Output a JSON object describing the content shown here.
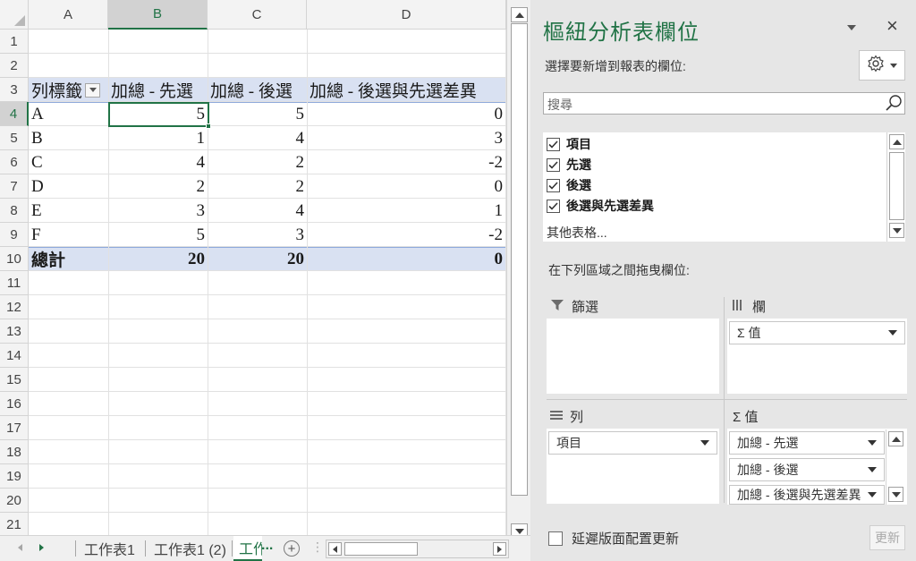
{
  "sheet": {
    "columns": [
      "A",
      "B",
      "C",
      "D"
    ],
    "rows": [
      "1",
      "2",
      "3",
      "4",
      "5",
      "6",
      "7",
      "8",
      "9",
      "10",
      "11",
      "12",
      "13",
      "14",
      "15",
      "16",
      "17",
      "18",
      "19",
      "20",
      "21"
    ],
    "pivot": {
      "header": [
        "列標籤",
        "加總 - 先選",
        "加總 - 後選",
        "加總 - 後選與先選差異"
      ],
      "data": [
        [
          "A",
          "5",
          "5",
          "0"
        ],
        [
          "B",
          "1",
          "4",
          "3"
        ],
        [
          "C",
          "4",
          "2",
          "-2"
        ],
        [
          "D",
          "2",
          "2",
          "0"
        ],
        [
          "E",
          "3",
          "4",
          "1"
        ],
        [
          "F",
          "5",
          "3",
          "-2"
        ]
      ],
      "total": [
        "總計",
        "20",
        "20",
        "0"
      ]
    },
    "active_cell": "B4"
  },
  "tabs": {
    "items": [
      "工作表1",
      "工作表1 (2)",
      "工作表"
    ],
    "active_index": 2,
    "more": "...",
    "add": "+"
  },
  "pane": {
    "title": "樞紐分析表欄位",
    "close": "×",
    "choose_label": "選擇要新增到報表的欄位:",
    "search_placeholder": "搜尋",
    "fields": [
      {
        "label": "項目",
        "checked": true
      },
      {
        "label": "先選",
        "checked": true
      },
      {
        "label": "後選",
        "checked": true
      },
      {
        "label": "後選與先選差異",
        "checked": true
      }
    ],
    "more_tables": "其他表格...",
    "drag_label": "在下列區域之間拖曳欄位:",
    "areas": {
      "filters": {
        "label": "篩選",
        "items": []
      },
      "columns": {
        "label": "欄",
        "items": [
          "Σ 值"
        ]
      },
      "rows": {
        "label": "列",
        "items": [
          "項目"
        ]
      },
      "values": {
        "label": "Σ 值",
        "items": [
          "加總 - 先選",
          "加總 - 後選",
          "加總 - 後選與先選差異"
        ]
      }
    },
    "defer_label": "延遲版面配置更新",
    "update_label": "更新"
  },
  "colors": {
    "accent": "#217346",
    "band": "#d9e1f2",
    "band_line": "#8ea9db",
    "pane_bg": "#e6e6e6"
  },
  "icons": [
    "filter-icon",
    "gear-icon",
    "search-icon",
    "checkbox-icon",
    "columns-icon",
    "rows-icon",
    "sigma-icon",
    "close-icon",
    "dropdown-arrow-icon",
    "add-sheet-icon"
  ]
}
